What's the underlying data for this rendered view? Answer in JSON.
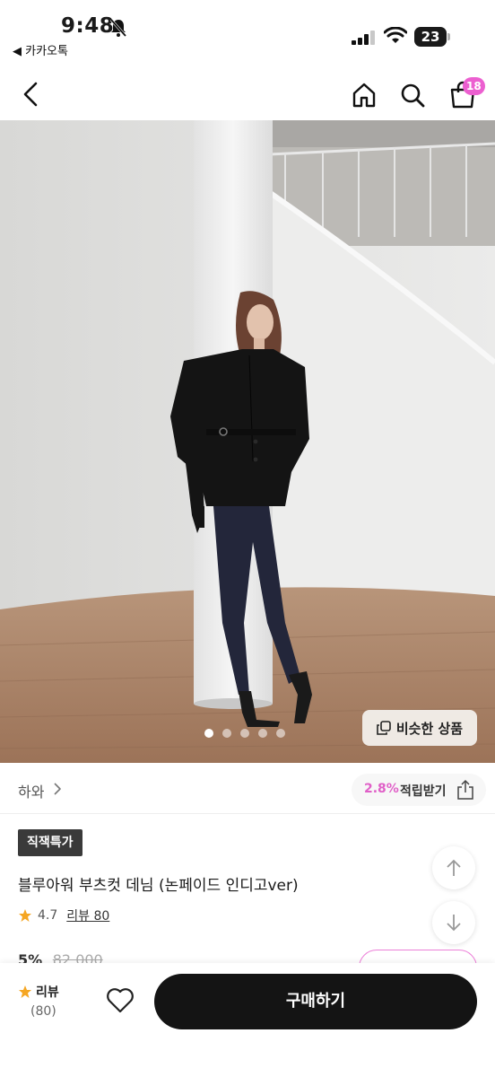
{
  "status_bar": {
    "time": "9:48",
    "back_app": "◀ 카카오톡",
    "battery": "23"
  },
  "header": {
    "cart_count": "18"
  },
  "hero": {
    "slide_count": 5,
    "active_slide": 1,
    "similar_button_label": "비슷한 상품"
  },
  "brand": {
    "name": "하와",
    "points_rate": "2.8%",
    "points_label": "적립받기"
  },
  "product": {
    "badge": "직잭특가",
    "title": "블루아워 부츠컷 데님 (논페이드 인디고ver)",
    "rating": "4.7",
    "review_link": "리뷰 80",
    "discount": "5%",
    "original_price": "82,000"
  },
  "bottom_bar": {
    "review_label": "리뷰",
    "review_count": "(80)",
    "buy_label": "구매하기"
  },
  "colors": {
    "accent_pink": "#ec5fd0",
    "buy_button": "#141414",
    "deal_badge": "#3a3a3a",
    "star": "#f5a623"
  }
}
